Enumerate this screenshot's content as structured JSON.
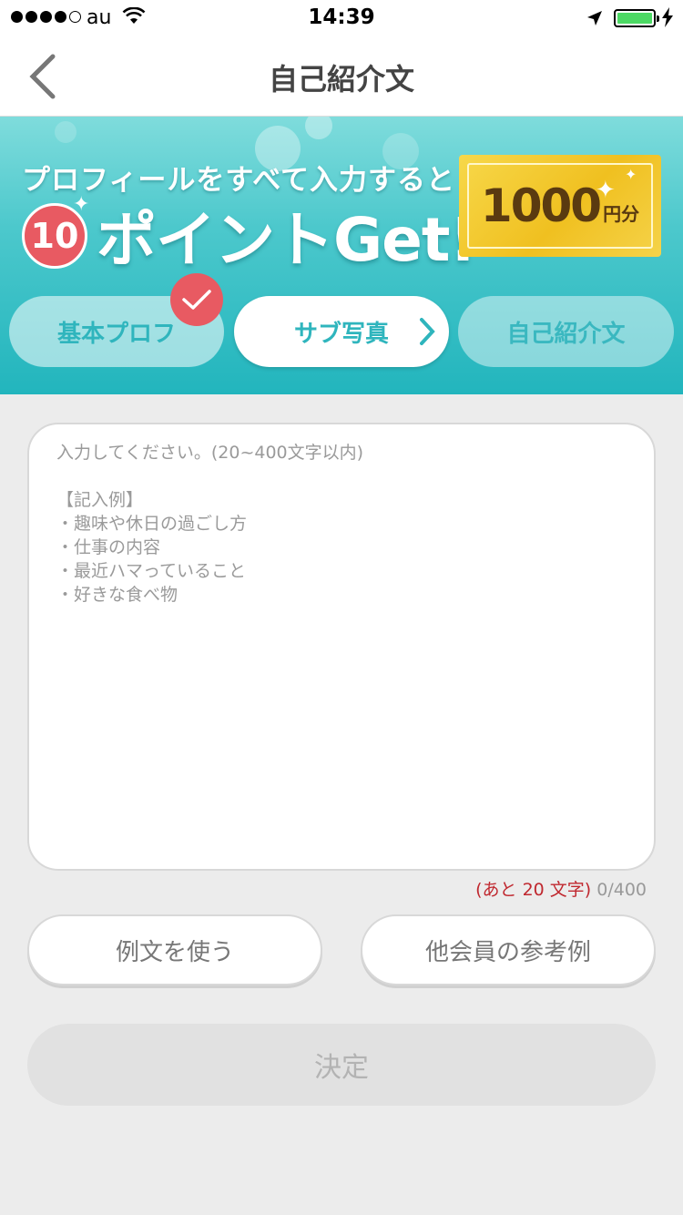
{
  "status_bar": {
    "carrier": "au",
    "time": "14:39"
  },
  "nav": {
    "title": "自己紹介文"
  },
  "banner": {
    "line1": "プロフィールをすべて入力すると",
    "points_number": "10",
    "line2": "ポイントGet!",
    "ticket_amount": "1000",
    "ticket_unit": "円分",
    "steps": [
      {
        "label": "基本プロフ",
        "state": "done"
      },
      {
        "label": "サブ写真",
        "state": "current"
      },
      {
        "label": "自己紹介文",
        "state": "todo"
      }
    ]
  },
  "editor": {
    "placeholder": "入力してください。(20~400文字以内)\n\n【記入例】\n・趣味や休日の過ごし方\n・仕事の内容\n・最近ハマっていること\n・好きな食べ物",
    "remaining": "(あと 20 文字)",
    "count": "0/400"
  },
  "buttons": {
    "use_example": "例文を使う",
    "other_members": "他会員の参考例",
    "submit": "決定"
  },
  "colors": {
    "accent": "#2fb5bd",
    "badge": "#e85a62",
    "warning": "#c0282f"
  }
}
